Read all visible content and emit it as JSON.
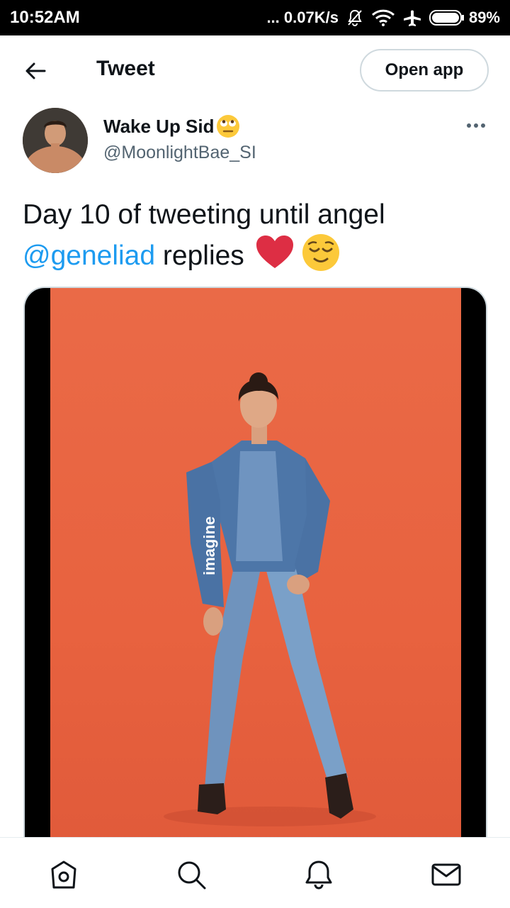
{
  "status_bar": {
    "time": "10:52AM",
    "network_speed": "... 0.07K/s",
    "battery": "89%"
  },
  "header": {
    "title": "Tweet",
    "open_app_label": "Open app"
  },
  "author": {
    "display_name": "Wake Up Sid",
    "username": "@MoonlightBae_SI"
  },
  "tweet": {
    "text_before_mention": "Day 10 of tweeting until angel",
    "mention": "@geneliad",
    "text_after_mention": "replies"
  },
  "media": {
    "printed_text": "imagine"
  },
  "bottom_nav": {
    "items": [
      "home-icon",
      "search-icon",
      "notifications-icon",
      "messages-icon"
    ]
  },
  "colors": {
    "link": "#1d9bf0",
    "secondary_text": "#536471",
    "photo_background": "#e8623f"
  }
}
